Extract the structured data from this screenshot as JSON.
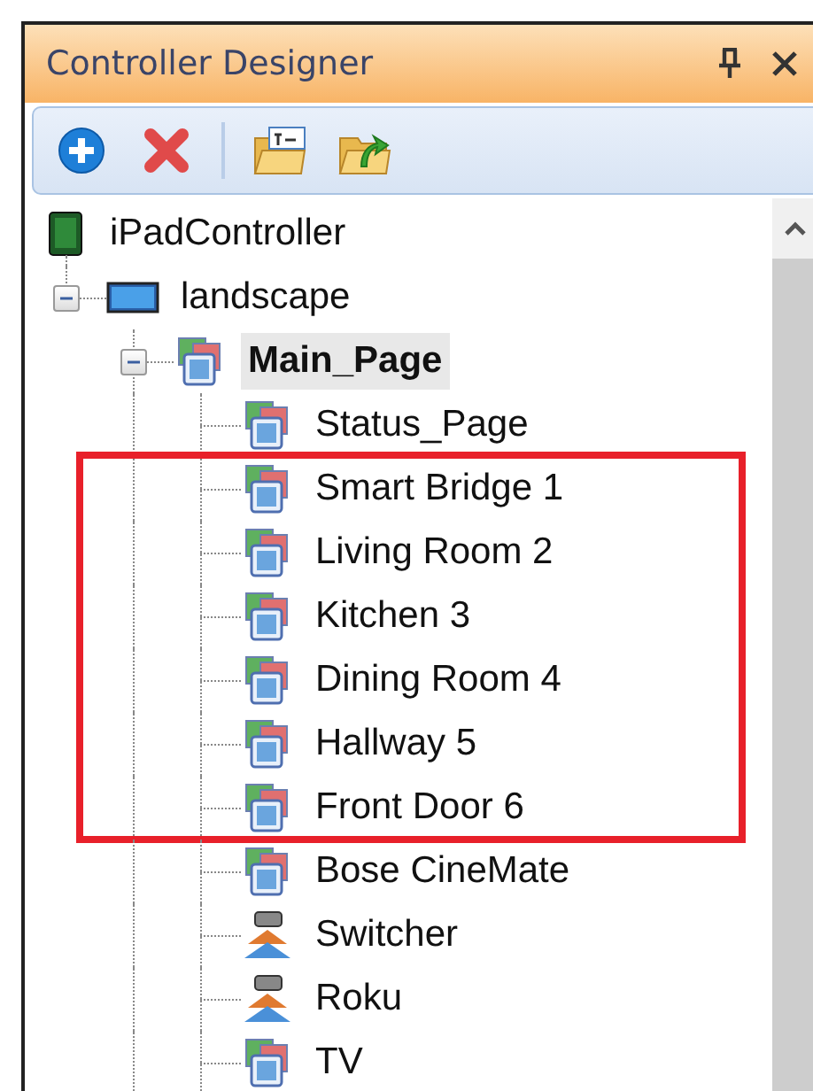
{
  "panel": {
    "title": "Controller Designer"
  },
  "toolbar": {
    "buttons": [
      {
        "kind": "add"
      },
      {
        "kind": "delete"
      },
      {
        "kind": "separator"
      },
      {
        "kind": "rename"
      },
      {
        "kind": "export"
      }
    ]
  },
  "tree": [
    {
      "label": "iPadController",
      "kind": "device",
      "selected": false,
      "highlighted": false,
      "children": [
        {
          "label": "landscape",
          "kind": "screen",
          "selected": false,
          "highlighted": false,
          "expanded": true,
          "children": [
            {
              "label": "Main_Page",
              "kind": "page",
              "selected": true,
              "highlighted": false,
              "expanded": true,
              "children": [
                {
                  "label": "Status_Page",
                  "kind": "page",
                  "selected": false,
                  "highlighted": false
                },
                {
                  "label": "Smart Bridge 1",
                  "kind": "page",
                  "selected": false,
                  "highlighted": true
                },
                {
                  "label": "Living Room 2",
                  "kind": "page",
                  "selected": false,
                  "highlighted": true
                },
                {
                  "label": "Kitchen 3",
                  "kind": "page",
                  "selected": false,
                  "highlighted": true
                },
                {
                  "label": "Dining Room 4",
                  "kind": "page",
                  "selected": false,
                  "highlighted": true
                },
                {
                  "label": "Hallway 5",
                  "kind": "page",
                  "selected": false,
                  "highlighted": true
                },
                {
                  "label": "Front Door 6",
                  "kind": "page",
                  "selected": false,
                  "highlighted": true
                },
                {
                  "label": "Bose CineMate",
                  "kind": "page",
                  "selected": false,
                  "highlighted": false
                },
                {
                  "label": "Switcher",
                  "kind": "switcher",
                  "selected": false,
                  "highlighted": false
                },
                {
                  "label": "Roku",
                  "kind": "switcher",
                  "selected": false,
                  "highlighted": false
                },
                {
                  "label": "TV",
                  "kind": "page",
                  "selected": false,
                  "highlighted": false
                }
              ]
            }
          ]
        }
      ]
    }
  ]
}
